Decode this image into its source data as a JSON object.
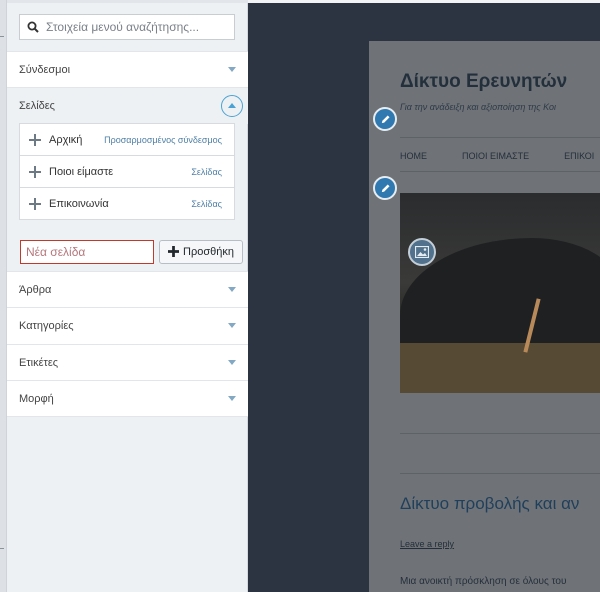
{
  "search": {
    "placeholder": "Στοιχεία μενού αναζήτησης..."
  },
  "sections": {
    "links": "Σύνδεσμοι",
    "pages": "Σελίδες",
    "posts": "Άρθρα",
    "categories": "Κατηγορίες",
    "tags": "Ετικέτες",
    "format": "Μορφή"
  },
  "pages": [
    {
      "title": "Αρχική",
      "type": "Προσαρμοσμένος σύνδεσμος"
    },
    {
      "title": "Ποιοι είμαστε",
      "type": "Σελίδας"
    },
    {
      "title": "Επικοινωνία",
      "type": "Σελίδας"
    }
  ],
  "new_page": {
    "placeholder": "Νέα σελίδα"
  },
  "add_button": {
    "label": "Προσθήκη"
  },
  "preview": {
    "site_title": "Δίκτυο Ερευνητών",
    "site_description": "Για την ανάδειξη και αξιοποίηση της Κοι",
    "nav": [
      "HOME",
      "ΠΟΙΟΙ ΕΙΜΑΣΤΕ",
      "ΕΠΙΚΟΙ"
    ],
    "post_title": "Δίκτυο προβολής και αν",
    "leave_reply": "Leave a reply",
    "excerpt": "Μια ανοικτή πρόσκληση σε όλους του"
  },
  "icons": {
    "search": "search-icon",
    "chevron": "chevron-down-icon",
    "collapse": "chevron-up-icon",
    "plus": "plus-icon",
    "edit": "pencil-icon",
    "image": "image-icon"
  },
  "colors": {
    "accent": "#4aa3d4",
    "error_border": "#c0392b",
    "edit_pin": "#2f78b0"
  }
}
